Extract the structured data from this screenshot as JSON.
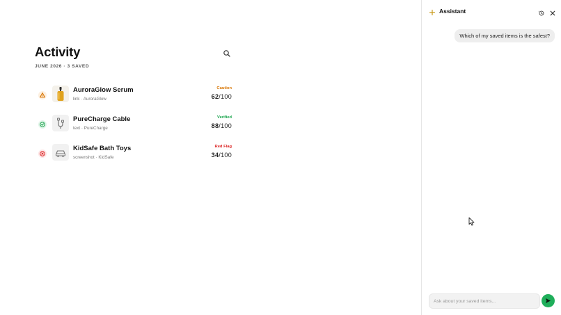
{
  "activity": {
    "title": "Activity",
    "subtitle": "JUNE 2026 · 3 SAVED",
    "items": [
      {
        "name": "AuroraGlow Serum",
        "meta": "link · AuroraGlow",
        "badge": "Caution",
        "score": "62",
        "score_suffix": "/100",
        "status": "caution",
        "status_icon": "warning-icon",
        "thumb_icon": "serum-bottle-icon",
        "color": "#d97706"
      },
      {
        "name": "PureCharge Cable",
        "meta": "text · PureCharge",
        "badge": "Verified",
        "score": "88",
        "score_suffix": "/100",
        "status": "verified",
        "status_icon": "check-circle-icon",
        "thumb_icon": "cable-icon",
        "color": "#16a34a"
      },
      {
        "name": "KidSafe Bath Toys",
        "meta": "screenshot · KidSafe",
        "badge": "Red Flag",
        "score": "34",
        "score_suffix": "/100",
        "status": "red-flag",
        "status_icon": "x-circle-icon",
        "thumb_icon": "toy-car-icon",
        "color": "#dc2626"
      }
    ]
  },
  "assistant": {
    "title": "Assistant",
    "user_message": "Which of my saved items is the safest?",
    "input_placeholder": "Ask about your saved items...",
    "input_value": "",
    "accent": "#1fae5a"
  }
}
